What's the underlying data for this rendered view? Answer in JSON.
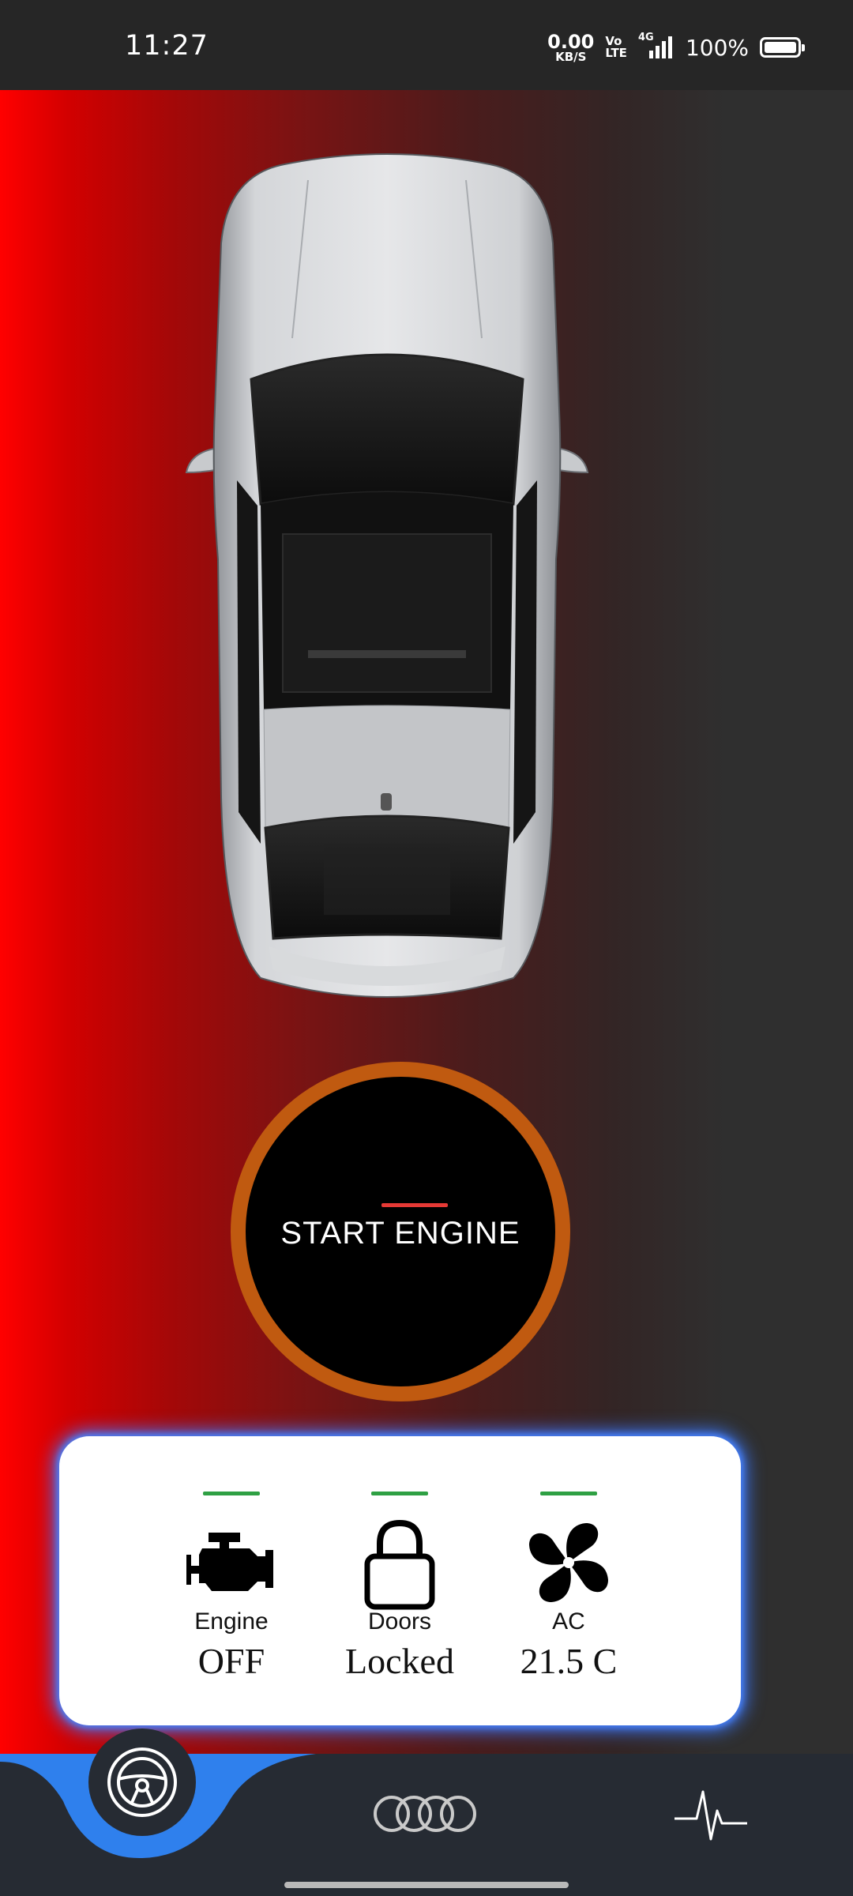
{
  "status_bar": {
    "time": "11:27",
    "net_speed_value": "0.00",
    "net_speed_unit": "KB/S",
    "volte_top": "Vo",
    "volte_bottom": "LTE",
    "network": "4G",
    "battery": "100%"
  },
  "start_button": {
    "label": "START ENGINE"
  },
  "status_card": {
    "items": [
      {
        "label": "Engine",
        "value": "OFF",
        "icon": "engine-icon"
      },
      {
        "label": "Doors",
        "value": "Locked",
        "icon": "lock-icon"
      },
      {
        "label": "AC",
        "value": "21.5 C",
        "icon": "fan-icon"
      }
    ]
  },
  "bottom_nav": {
    "items": [
      "steering-wheel-icon",
      "audi-rings-icon",
      "pulse-icon"
    ]
  },
  "colors": {
    "accent_red": "#e53935",
    "ring_orange": "#c05a10",
    "status_green": "#2ea043",
    "glow_blue": "#3c78ff",
    "nav_blue": "#2f80ed"
  }
}
